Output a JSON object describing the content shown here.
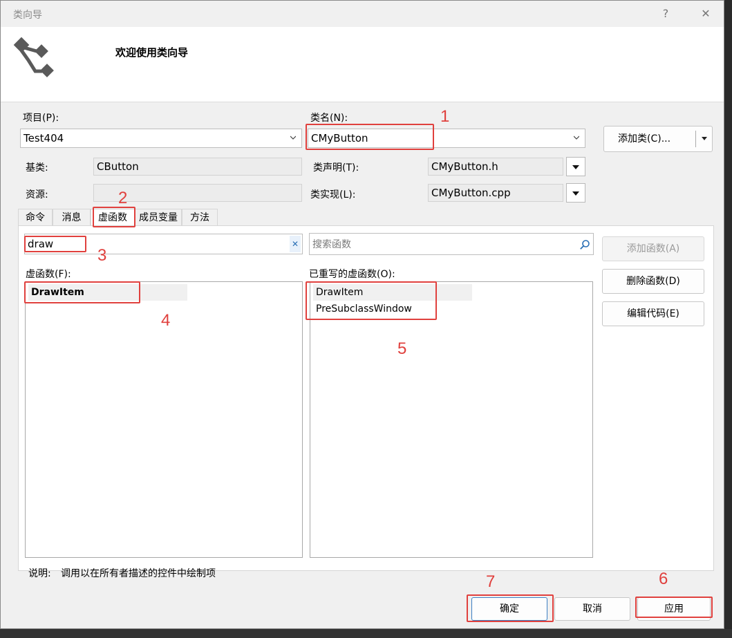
{
  "window": {
    "title": "类向导",
    "help_glyph": "?",
    "close_glyph": "✕"
  },
  "banner": {
    "welcome": "欢迎使用类向导"
  },
  "project": {
    "label": "项目(P):",
    "value": "Test404"
  },
  "classname": {
    "label": "类名(N):",
    "value": "CMyButton"
  },
  "add_class": {
    "label": "添加类(C)..."
  },
  "base": {
    "label": "基类:",
    "value": "CButton"
  },
  "resource": {
    "label": "资源:",
    "value": ""
  },
  "decl": {
    "label": "类声明(T):",
    "value": "CMyButton.h"
  },
  "impl": {
    "label": "类实现(L):",
    "value": "CMyButton.cpp"
  },
  "tabs": [
    "命令",
    "消息",
    "虚函数",
    "成员变量",
    "方法"
  ],
  "filter": {
    "value": "draw",
    "clear_glyph": "✕"
  },
  "search": {
    "placeholder": "搜索函数"
  },
  "virtuals": {
    "label": "虚函数(F):",
    "items": [
      "DrawItem"
    ]
  },
  "overridden": {
    "label": "已重写的虚函数(O):",
    "items": [
      "DrawItem",
      "PreSubclassWindow"
    ]
  },
  "buttons": {
    "add": "添加函数(A)",
    "delete": "删除函数(D)",
    "edit": "编辑代码(E)"
  },
  "description": {
    "label": "说明:",
    "text": "调用以在所有者描述的控件中绘制项"
  },
  "footer": {
    "ok": "确定",
    "cancel": "取消",
    "apply": "应用"
  },
  "annotations": [
    "1",
    "2",
    "3",
    "4",
    "5",
    "6",
    "7"
  ],
  "colors": {
    "annotation": "#e0403d",
    "dialog_bg": "#f0f0f0"
  }
}
